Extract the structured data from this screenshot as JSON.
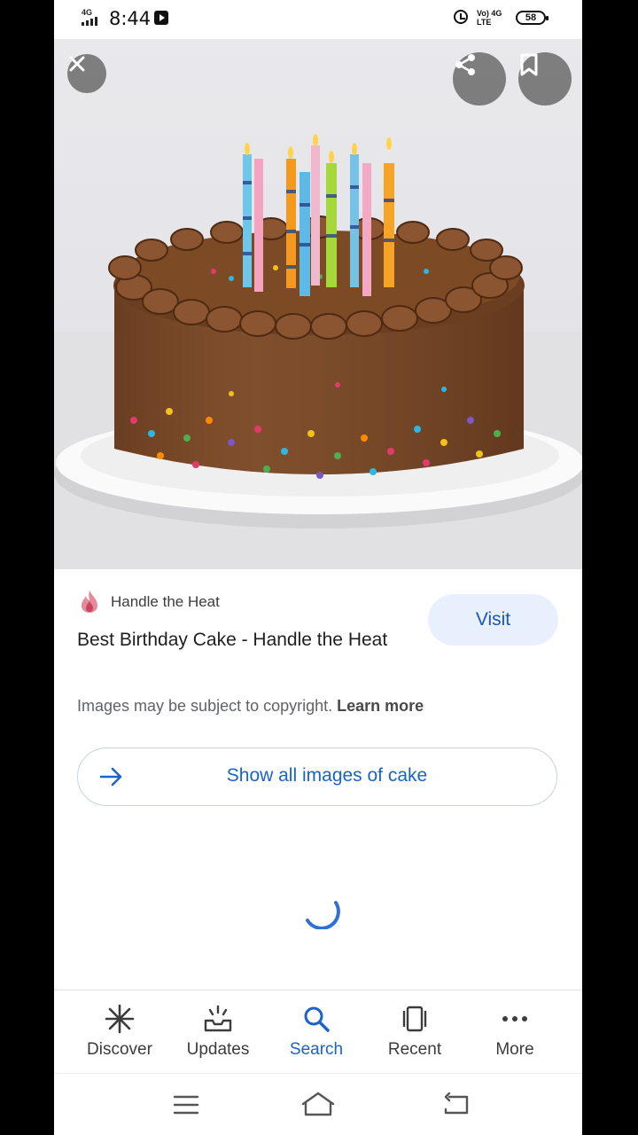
{
  "status_bar": {
    "network": "4G",
    "time": "8:44",
    "volte_top": "Vo) 4G",
    "volte_bottom": "LTE",
    "battery": "58"
  },
  "source": {
    "name": "Handle the Heat"
  },
  "result": {
    "title": "Best Birthday Cake - Handle the Heat",
    "visit_label": "Visit",
    "copyright_text": "Images may be subject to copyright.",
    "learn_more": "Learn more"
  },
  "show_all": {
    "label": "Show all images of cake"
  },
  "bottom_nav": {
    "items": [
      {
        "label": "Discover",
        "icon": "asterisk-icon"
      },
      {
        "label": "Updates",
        "icon": "updates-icon"
      },
      {
        "label": "Search",
        "icon": "search-icon"
      },
      {
        "label": "Recent",
        "icon": "recent-icon"
      },
      {
        "label": "More",
        "icon": "more-dots-icon"
      }
    ],
    "active": "Search"
  },
  "colors": {
    "accent": "#1a63c8",
    "visit_bg": "#e8f0fe"
  }
}
